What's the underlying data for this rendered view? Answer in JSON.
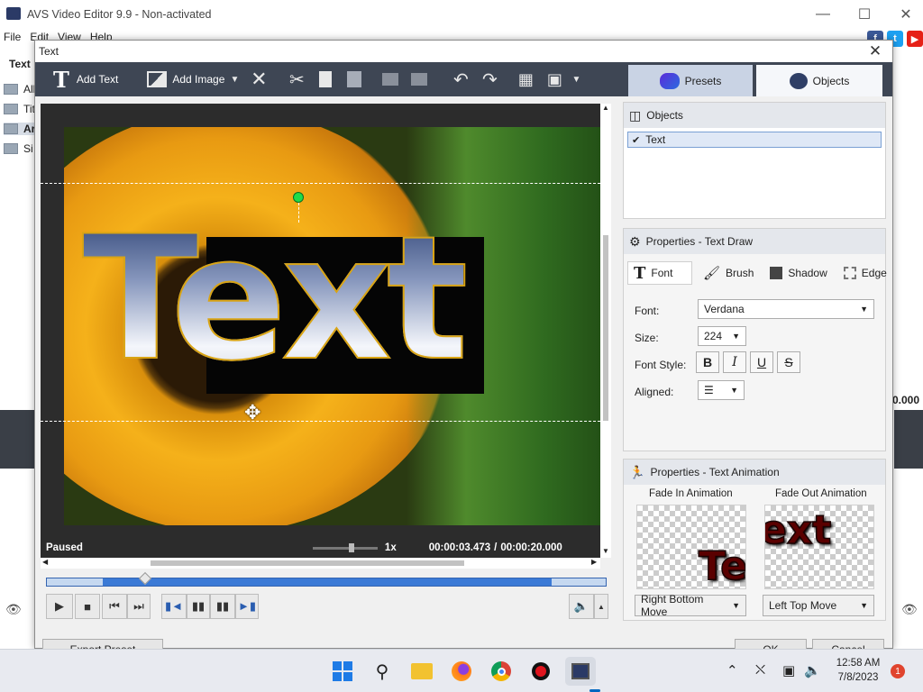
{
  "app": {
    "title": "AVS Video Editor 9.9 - Non-activated",
    "menu": [
      "File",
      "Edit",
      "View",
      "Help"
    ],
    "left_header": "Text",
    "left_items": [
      "All",
      "Tit",
      "Ar",
      "Si"
    ],
    "right_partial_time": "0.000"
  },
  "dialog": {
    "title": "Text",
    "toolbar": {
      "add_text": "Add Text",
      "add_image": "Add Image"
    },
    "tabs": {
      "presets": "Presets",
      "objects": "Objects"
    },
    "preview": {
      "overlay_text": "Text",
      "status": "Paused",
      "speed": "1x",
      "time_current": "00:00:03.473",
      "time_separator": "/",
      "time_total": "00:00:20.000"
    },
    "objects_panel": {
      "title": "Objects",
      "items": [
        {
          "label": "Text",
          "checked": true
        }
      ]
    },
    "properties": {
      "title": "Properties - Text Draw",
      "tabs": [
        "Font",
        "Brush",
        "Shadow",
        "Edge"
      ],
      "font_label": "Font:",
      "font_value": "Verdana",
      "size_label": "Size:",
      "size_value": "224",
      "style_label": "Font Style:",
      "style_buttons": [
        "B",
        "I",
        "U",
        "S"
      ],
      "aligned_label": "Aligned:"
    },
    "animation": {
      "title": "Properties - Text Animation",
      "fade_in_label": "Fade In Animation",
      "fade_out_label": "Fade Out Animation",
      "fade_in_preview": "Te",
      "fade_out_preview": "ext",
      "fade_in_value": "Right Bottom Move",
      "fade_out_value": "Left Top Move"
    },
    "footer": {
      "left_button": "Export Preset",
      "ok": "OK",
      "cancel": "Cancel"
    }
  },
  "taskbar": {
    "time": "12:58 AM",
    "date": "7/8/2023",
    "notification_count": "1"
  },
  "colors": {
    "toolbar_bg": "#3e4654",
    "accent_blue": "#3b7ad6",
    "handle_green": "#1fdc4a"
  }
}
